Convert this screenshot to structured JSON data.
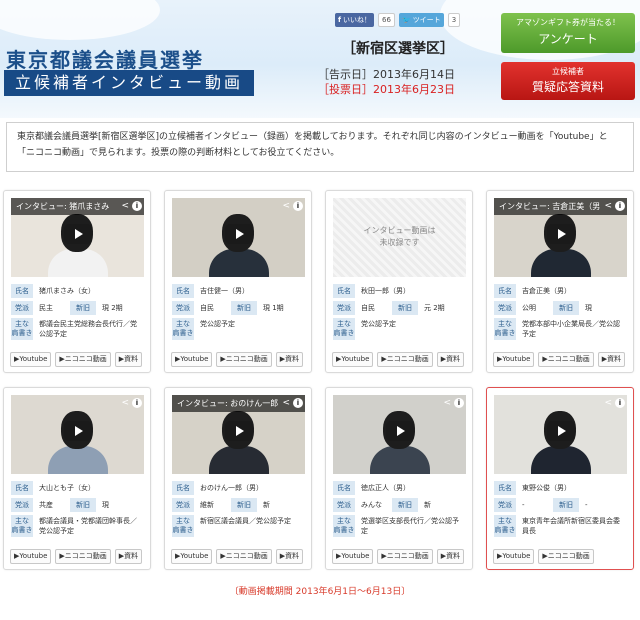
{
  "header": {
    "title": "東京都議会議員選挙",
    "subtitle": "立候補者インタビュー動画",
    "district": "［新宿区選挙区］",
    "notice_date": "［告示日］2013年6月14日",
    "vote_date": "［投票日］2013年6月23日",
    "social": {
      "like_label": "いいね！",
      "like_count": "66",
      "tweet_label": "ツイート",
      "tweet_count": "3"
    },
    "survey_button": {
      "line1": "アマゾンギフト券が当たる！",
      "line2": "アンケート"
    },
    "qa_button": {
      "line1": "立候補者",
      "line2": "質疑応答資料"
    }
  },
  "intro": "東京都議会議員選挙[新宿区選挙区]の立候補者インタビュー（録画）を掲載しております。それぞれ同じ内容のインタビュー動画を「Youtube」と「ニコニコ動画」で見られます。投票の際の判断材料としてお役立てください。",
  "labels": {
    "name": "氏名",
    "party": "党派",
    "bio_l1": "主な",
    "bio_l2": "肩書き",
    "youtube": "▶Youtube",
    "nico": "▶ニコニコ動画",
    "doc": "▶資料",
    "video_placeholder": "インタビュー動画は\n未収録です"
  },
  "candidates": [
    {
      "video_title": "インタビュー: 猪爪まさみ",
      "name": "猪爪まさみ（女）",
      "party": "民主",
      "status": "新旧",
      "count": "現 2期",
      "bio": "都議会民主党総務会長代行／党公認予定"
    },
    {
      "video_title": "",
      "name": "吉住健一（男）",
      "party": "自民",
      "status": "新旧",
      "count": "現 1期",
      "bio": "党公認予定"
    },
    {
      "video_title": "",
      "name": "秋田一郎（男）",
      "party": "自民",
      "status": "新旧",
      "count": "元 2期",
      "bio": "党公認予定"
    },
    {
      "video_title": "インタビュー: 吉倉正美（男",
      "name": "吉倉正美（男）",
      "party": "公明",
      "status": "新旧",
      "count": "現",
      "bio": "党都本部中小企業局長／党公認予定"
    },
    {
      "video_title": "",
      "name": "大山とも子（女）",
      "party": "共産",
      "status": "新旧",
      "count": "現",
      "bio": "都議会議員・党都議団幹事長／党公認予定"
    },
    {
      "video_title": "インタビュー: おのけん一郎",
      "name": "おのけん一郎（男）",
      "party": "維新",
      "status": "新旧",
      "count": "新",
      "bio": "新宿区議会議員／党公認予定"
    },
    {
      "video_title": "",
      "name": "徳広正人（男）",
      "party": "みんな",
      "status": "新旧",
      "count": "新",
      "bio": "党選挙区支部長代行／党公認予定"
    },
    {
      "video_title": "",
      "name": "東野公俊（男）",
      "party": "-",
      "status": "新旧",
      "count": "-",
      "bio": "東京青年会議所新宿区委員会委員長"
    }
  ],
  "period": "〔動画掲載期間 2013年6月1日～6月13日〕"
}
